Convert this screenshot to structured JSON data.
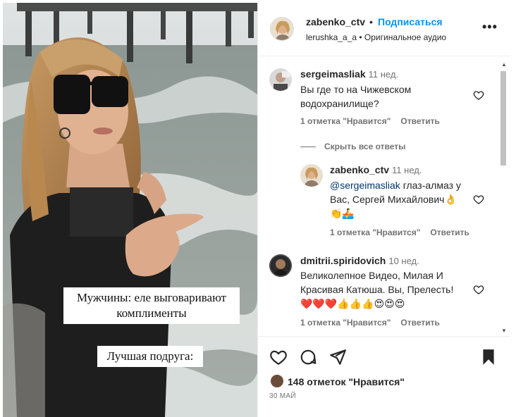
{
  "video": {
    "caption_1": "Мужчины: еле выговаривают комплименты",
    "caption_2": "Лучшая подруга:"
  },
  "header": {
    "username": "zabenko_ctv",
    "separator": "•",
    "follow_label": "Подписаться",
    "subline": "lerushka_a_a • Оригинальное аудио",
    "more_icon": "more-dots-icon"
  },
  "comments": [
    {
      "username": "sergeimasliak",
      "time": "11 нед.",
      "text_line1": "Вы где то на Чижевском",
      "text_line2": "водохранилище?",
      "likes": "1 отметка \"Нравится\"",
      "reply_label": "Ответить"
    },
    {
      "username": "dmitrii.spiridovich",
      "time": "10 нед.",
      "text_line1": "Великолепное Видео, Милая И",
      "text_line2": "Красивая Катюша. Вы, Прелесть!",
      "emoji": "❤️❤️❤️👍👍👍😍😍😍",
      "likes": "1 отметка \"Нравится\"",
      "reply_label": "Ответить"
    }
  ],
  "hide_replies_label": "Скрыть все ответы",
  "reply": {
    "username": "zabenko_ctv",
    "time": "11 нед.",
    "mention": "@sergeimasliak",
    "text_rest": " глаз-алмаз у",
    "text_line2": "Вас, Сергей Михайлович👌",
    "emoji": "👏🚣",
    "likes": "1 отметка \"Нравится\"",
    "reply_label": "Ответить"
  },
  "footer": {
    "likes_label": "148 отметок \"Нравится\"",
    "date": "30 МАЙ",
    "icons": [
      "heart-icon",
      "comment-icon",
      "share-icon",
      "bookmark-icon"
    ]
  },
  "colors": {
    "accent": "#0095f6",
    "mention": "#00376b",
    "muted": "#737373"
  }
}
